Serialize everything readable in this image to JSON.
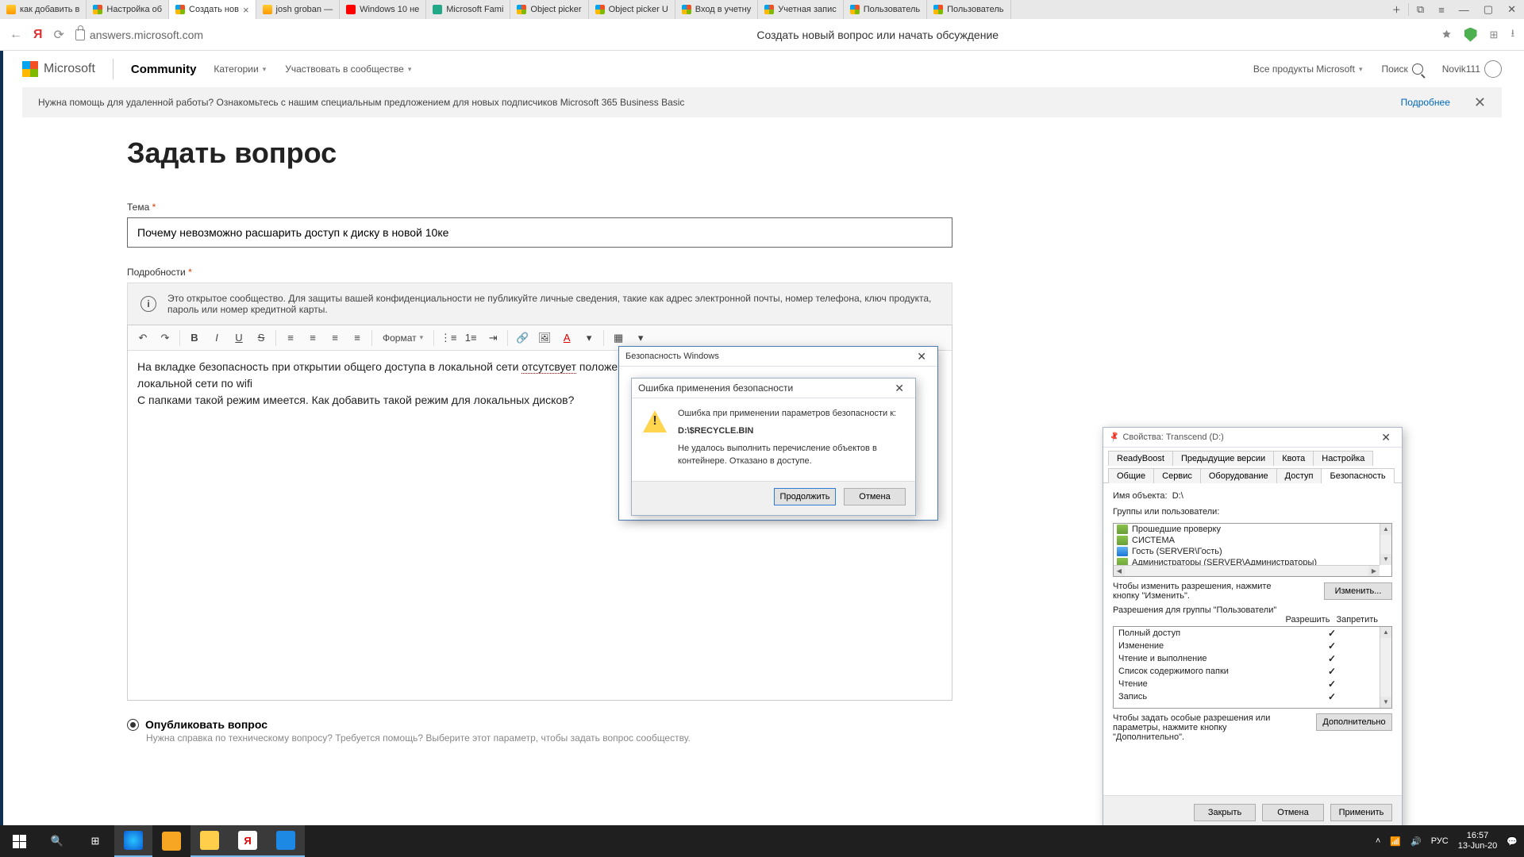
{
  "browser": {
    "tabs": [
      {
        "label": "как добавить в"
      },
      {
        "label": "Настройка об"
      },
      {
        "label": "Создать нов",
        "active": true
      },
      {
        "label": "josh groban —"
      },
      {
        "label": "Windows 10 не"
      },
      {
        "label": "Microsoft Fami"
      },
      {
        "label": "Object picker"
      },
      {
        "label": "Object picker U"
      },
      {
        "label": "Вход в учетну"
      },
      {
        "label": "Учетная запис"
      },
      {
        "label": "Пользователь"
      },
      {
        "label": "Пользователь"
      }
    ],
    "url": "answers.microsoft.com",
    "page_title": "Создать новый вопрос или начать обсуждение"
  },
  "header": {
    "brand": "Microsoft",
    "community": "Community",
    "nav": {
      "categories": "Категории",
      "participate": "Участвовать в сообществе"
    },
    "right": {
      "products": "Все продукты Microsoft",
      "search": "Поиск",
      "user": "Novik111"
    }
  },
  "banner": {
    "text": "Нужна помощь для удаленной работы? Ознакомьтесь с нашим специальным предложением для новых подписчиков Microsoft 365 Business Basic",
    "link": "Подробнее"
  },
  "page": {
    "h1": "Задать вопрос",
    "subject_label": "Тема",
    "subject_value": "Почему невозможно расшарить доступ к диску в новой 10ке",
    "details_label": "Подробности",
    "notice": "Это открытое сообщество. Для защиты вашей конфиденциальности не публикуйте личные сведения, такие как адрес электронной почты, номер телефона, ключ продукта, пароль или номер кредитной карты.",
    "format": "Формат",
    "body_line1a": "На вкладке  безопасность при открытии общего доступа в локальной сети ",
    "body_misspell": "отсутсвует",
    "body_line1b": " положение: все (это пользователи входят в группу только как члены локальной сети по wifi",
    "body_line2": "С папками такой режим имеется. Как добавить такой режим для локальных дисков?",
    "radio_label": "Опубликовать вопрос",
    "radio_hint": "Нужна справка по техническому вопросу? Требуется помощь? Выберите этот параметр, чтобы задать вопрос сообществу."
  },
  "dlg_outer": {
    "title": "Безопасность Windows"
  },
  "dlg_err": {
    "title": "Ошибка применения безопасности",
    "line1": "Ошибка при применении параметров безопасности к:",
    "path": "D:\\$RECYCLE.BIN",
    "line2": "Не удалось выполнить перечисление объектов в контейнере. Отказано в доступе.",
    "btn_continue": "Продолжить",
    "btn_cancel": "Отмена"
  },
  "props": {
    "title": "Свойства: Transcend (D:)",
    "tabs_top": [
      "ReadyBoost",
      "Предыдущие версии",
      "Квота",
      "Настройка"
    ],
    "tabs_bot": [
      "Общие",
      "Сервис",
      "Оборудование",
      "Доступ",
      "Безопасность"
    ],
    "obj_label": "Имя объекта:",
    "obj_value": "D:\\",
    "groups_label": "Группы или пользователи:",
    "groups": [
      "Прошедшие проверку",
      "СИСТЕМА",
      "Гость (SERVER\\Гость)",
      "Администраторы (SERVER\\Администраторы)"
    ],
    "edit_hint": "Чтобы изменить разрешения, нажмите кнопку \"Изменить\".",
    "edit_btn": "Изменить...",
    "perm_label": "Разрешения для группы \"Пользователи\"",
    "col_allow": "Разрешить",
    "col_deny": "Запретить",
    "perms": [
      {
        "name": "Полный доступ",
        "allow": true
      },
      {
        "name": "Изменение",
        "allow": true
      },
      {
        "name": "Чтение и выполнение",
        "allow": true
      },
      {
        "name": "Список содержимого папки",
        "allow": true
      },
      {
        "name": "Чтение",
        "allow": true
      },
      {
        "name": "Запись",
        "allow": true
      }
    ],
    "adv_hint": "Чтобы задать особые разрешения или параметры, нажмите кнопку \"Дополнительно\".",
    "adv_btn": "Дополнительно",
    "btn_close": "Закрыть",
    "btn_cancel": "Отмена",
    "btn_apply": "Применить"
  },
  "taskbar": {
    "lang": "РУС",
    "time": "16:57",
    "date": "13-Jun-20"
  }
}
